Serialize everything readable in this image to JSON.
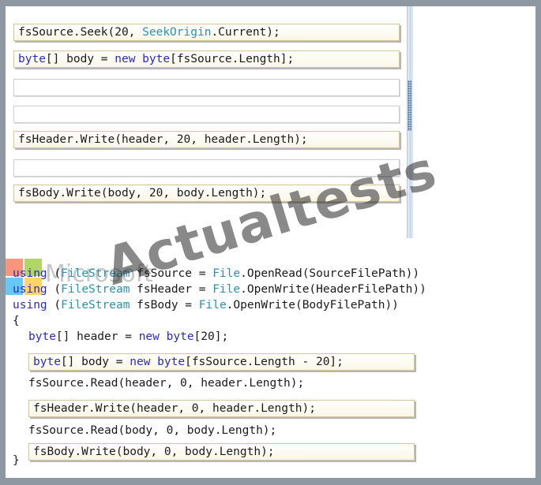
{
  "answer_area": {
    "slot_1": "fsSource.Seek(20, SeekOrigin.Current);",
    "slot_2": "byte[] body = new byte[fsSource.Length];",
    "slot_5": "fsHeader.Write(header, 20, header.Length);",
    "slot_7": "fsBody.Write(body, 20, body.Length);"
  },
  "code": {
    "line_1_kw": "using",
    "line_1_type": "FileStream",
    "line_1_rest_a": " fsSource = ",
    "line_1_class": "File",
    "line_1_rest_b": ".OpenRead(SourceFilePath))",
    "line_2_kw": "using",
    "line_2_type": "FileStream",
    "line_2_rest_a": " fsHeader = ",
    "line_2_class": "File",
    "line_2_rest_b": ".OpenWrite(HeaderFilePath))",
    "line_3_kw": "using",
    "line_3_type": "FileStream",
    "line_3_rest_a": " fsBody = ",
    "line_3_class": "File",
    "line_3_rest_b": ".OpenWrite(BodyFilePath))",
    "open_brace": "{",
    "line_5_a": "byte",
    "line_5_b": "[] header = ",
    "line_5_c": "new",
    "line_5_d": " ",
    "line_5_e": "byte",
    "line_5_f": "[20];",
    "target_1": "byte[] body = new byte[fsSource.Length - 20];",
    "line_7": "fsSource.Read(header, 0, header.Length);",
    "target_2": "fsHeader.Write(header, 0, header.Length);",
    "line_9": "fsSource.Read(body, 0, body.Length);",
    "target_3": "fsBody.Write(body, 0, body.Length);",
    "close_brace": "}"
  },
  "watermark": {
    "site": "Actualtests",
    "brand_text": "Microsoft",
    "logo_colors": [
      "#f25022",
      "#7fba00",
      "#00a4ef",
      "#ffb900"
    ]
  }
}
